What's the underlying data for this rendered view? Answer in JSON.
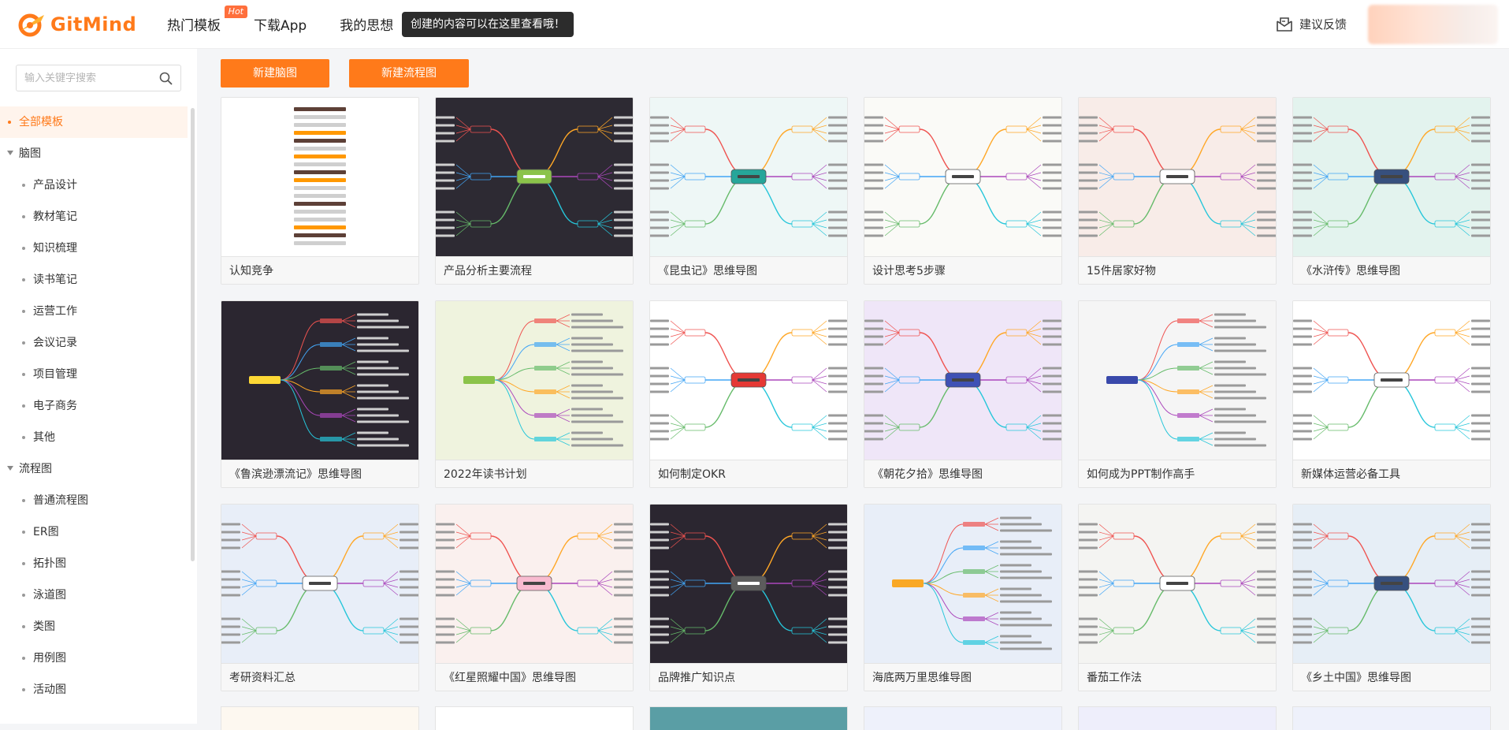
{
  "header": {
    "logo_text": "GitMind",
    "nav": [
      {
        "label": "热门模板",
        "badge": "Hot"
      },
      {
        "label": "下载App"
      },
      {
        "label": "我的思想"
      }
    ],
    "tooltip": "创建的内容可以在这里查看哦！",
    "feedback": "建议反馈"
  },
  "sidebar": {
    "search_placeholder": "输入关键字搜索",
    "items": [
      {
        "label": "全部模板",
        "level": 1,
        "active": true
      },
      {
        "label": "脑图",
        "level": 1,
        "group": true
      },
      {
        "label": "产品设计",
        "level": 2
      },
      {
        "label": "教材笔记",
        "level": 2
      },
      {
        "label": "知识梳理",
        "level": 2
      },
      {
        "label": "读书笔记",
        "level": 2
      },
      {
        "label": "运营工作",
        "level": 2
      },
      {
        "label": "会议记录",
        "level": 2
      },
      {
        "label": "项目管理",
        "level": 2
      },
      {
        "label": "电子商务",
        "level": 2
      },
      {
        "label": "其他",
        "level": 2
      },
      {
        "label": "流程图",
        "level": 1,
        "group": true
      },
      {
        "label": "普通流程图",
        "level": 2
      },
      {
        "label": "ER图",
        "level": 2
      },
      {
        "label": "拓扑图",
        "level": 2
      },
      {
        "label": "泳道图",
        "level": 2
      },
      {
        "label": "类图",
        "level": 2
      },
      {
        "label": "用例图",
        "level": 2
      },
      {
        "label": "活动图",
        "level": 2
      }
    ]
  },
  "actions": {
    "new_mindmap": "新建脑图",
    "new_flowchart": "新建流程图"
  },
  "templates": [
    {
      "title": "认知竞争",
      "bg": "#ffffff",
      "style": "vertical"
    },
    {
      "title": "产品分析主要流程",
      "bg": "#2d2a33",
      "style": "mind",
      "center": "#8bc34a"
    },
    {
      "title": "《昆虫记》思维导图",
      "bg": "#eef7f6",
      "style": "mind",
      "center": "#26a69a"
    },
    {
      "title": "设计思考5步骤",
      "bg": "#fafaf7",
      "style": "mind",
      "center": "#ffffff"
    },
    {
      "title": "15件居家好物",
      "bg": "#f8ece8",
      "style": "mind",
      "center": "#ffffff"
    },
    {
      "title": "《水浒传》思维导图",
      "bg": "#e3f3ee",
      "style": "mind",
      "center": "#37507e"
    },
    {
      "title": "《鲁滨逊漂流记》思维导图",
      "bg": "#2b2630",
      "style": "tree",
      "center": "#fdd835"
    },
    {
      "title": "2022年读书计划",
      "bg": "#eff3de",
      "style": "tree",
      "center": "#8bc34a"
    },
    {
      "title": "如何制定OKR",
      "bg": "#ffffff",
      "style": "mind",
      "center": "#e53935"
    },
    {
      "title": "《朝花夕拾》思维导图",
      "bg": "#efe6f8",
      "style": "mind",
      "center": "#3f51b5"
    },
    {
      "title": "如何成为PPT制作高手",
      "bg": "#f5f5f5",
      "style": "tree",
      "center": "#3949ab"
    },
    {
      "title": "新媒体运营必备工具",
      "bg": "#ffffff",
      "style": "mind",
      "center": "#ffffff"
    },
    {
      "title": "考研资料汇总",
      "bg": "#e8eef8",
      "style": "mind",
      "center": "#ffffff"
    },
    {
      "title": "《红星照耀中国》思维导图",
      "bg": "#faf0ee",
      "style": "mind",
      "center": "#f8bbd0"
    },
    {
      "title": "品牌推广知识点",
      "bg": "#2b2630",
      "style": "mind",
      "center": "#5c5c5c"
    },
    {
      "title": "海底两万里思维导图",
      "bg": "#e8eef8",
      "style": "tree",
      "center": "#f9a825"
    },
    {
      "title": "番茄工作法",
      "bg": "#f4f4f2",
      "style": "mind",
      "center": "#ffffff"
    },
    {
      "title": "《乡土中国》思维导图",
      "bg": "#e6eef6",
      "style": "mind",
      "center": "#37507e"
    }
  ],
  "partial_cards": [
    {
      "bg": "#fdf8f0"
    },
    {
      "bg": "#ffffff"
    },
    {
      "bg": "#5a9ea5"
    },
    {
      "bg": "#eef1fb"
    },
    {
      "bg": "#eeeefb"
    },
    {
      "bg": "#eef1fb"
    }
  ],
  "colors": {
    "accent": "#ff7a1a",
    "active_bg": "#fff4ec",
    "hot_badge": "#ff6f3c"
  }
}
